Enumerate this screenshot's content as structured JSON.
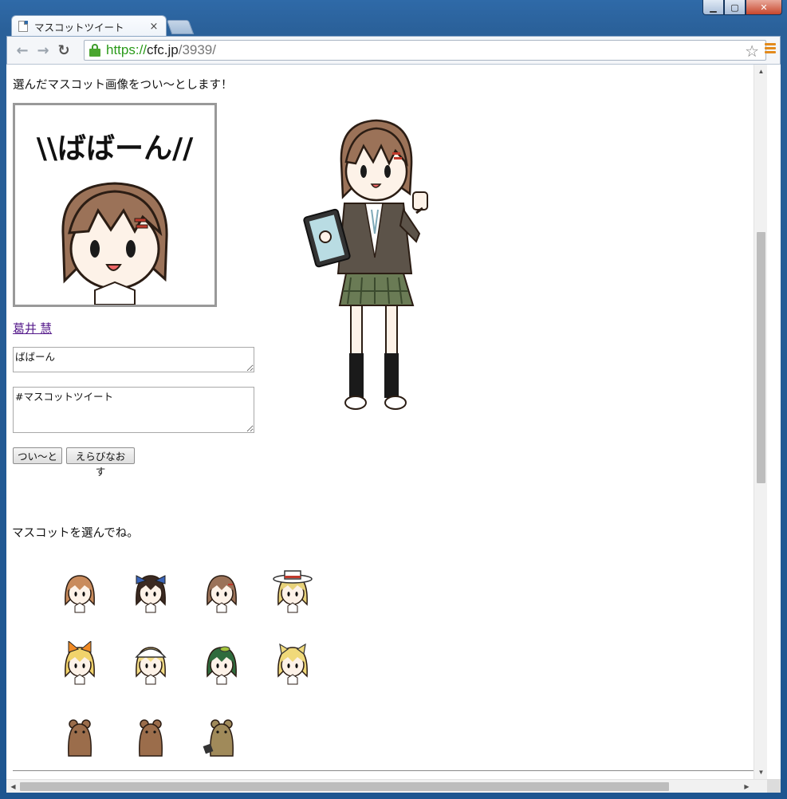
{
  "window": {
    "tab_title": "マスコットツイート",
    "tab_close": "×",
    "controls": {
      "minimize": "▁",
      "maximize": "▢",
      "close": "✕"
    }
  },
  "toolbar": {
    "back": "←",
    "forward": "→",
    "reload": "↻",
    "url_scheme": "https://",
    "url_host": "cfc.jp",
    "url_path": "/3939/",
    "star": "☆"
  },
  "page": {
    "intro_text": "選んだマスコット画像をつい～とします！",
    "preview_caption": "\\\\ばばーん//",
    "mascot_name": "葛井 慧",
    "message_value": "ばばーん",
    "hashtag_value": "#マスコットツイート",
    "tweet_button": "つい～と",
    "rechoose_button": "えらびなおす",
    "choose_text": "マスコットを選んでね。"
  },
  "thumbnails": [
    {
      "name": "mascot-orange-hair"
    },
    {
      "name": "mascot-blue-ribbon"
    },
    {
      "name": "mascot-brown-hair"
    },
    {
      "name": "mascot-white-hat"
    },
    {
      "name": "mascot-orange-bow"
    },
    {
      "name": "mascot-white-bonnet"
    },
    {
      "name": "mascot-green-hair"
    },
    {
      "name": "mascot-cat-ears"
    },
    {
      "name": "mascot-bear"
    },
    {
      "name": "mascot-bear-waving"
    },
    {
      "name": "mascot-bear-full"
    }
  ],
  "colors": {
    "hair": "#9b7258",
    "skin": "#fdf2e8",
    "skirt": "#6a7b55",
    "blazer": "#5c5349",
    "link": "#551a8b",
    "lock": "#4aa62f"
  }
}
